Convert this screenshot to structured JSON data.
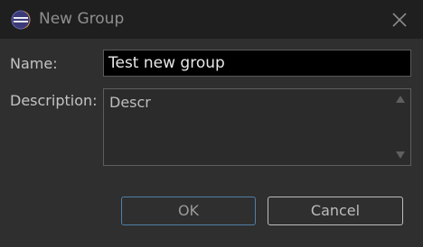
{
  "window": {
    "title": "New Group",
    "icon": "eclipse-icon"
  },
  "form": {
    "name_label": "Name:",
    "name_value": "Test new group",
    "description_label": "Description:",
    "description_value": "Descr"
  },
  "buttons": {
    "ok": "OK",
    "cancel": "Cancel"
  },
  "colors": {
    "background": "#2f2f2f",
    "titlebar": "#1f1f1f",
    "ok_border": "#4f7fa6"
  }
}
